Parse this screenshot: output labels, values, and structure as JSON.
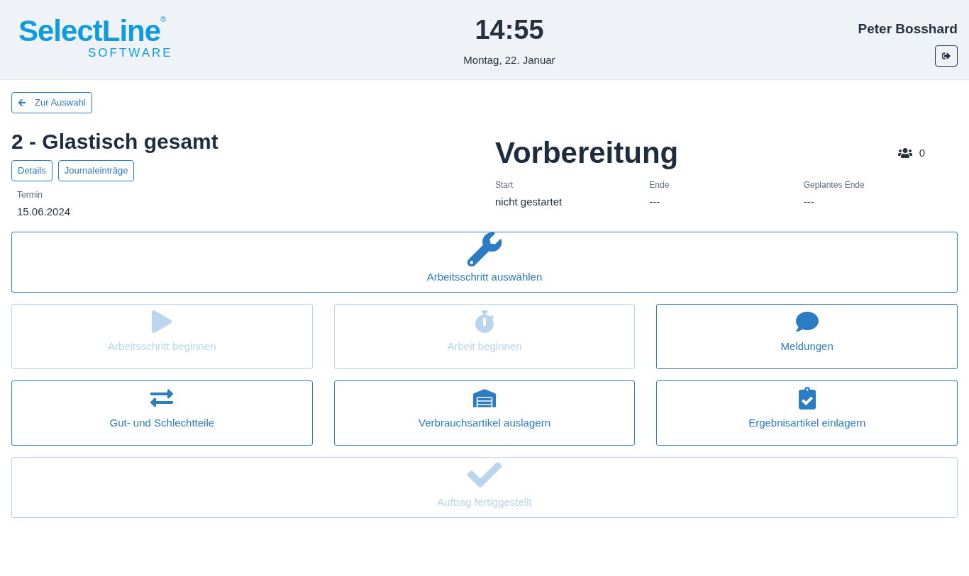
{
  "header": {
    "logo": {
      "name": "SelectLine",
      "mark": "®",
      "sub": "SOFTWARE"
    },
    "time": "14:55",
    "date": "Montag, 22. Januar",
    "user": "Peter Bosshard"
  },
  "back_button": "Zur Auswahl",
  "order": {
    "title": "2 - Glastisch gesamt",
    "buttons": [
      "Details",
      "Journaleinträge"
    ],
    "fields": [
      {
        "label": "Termin",
        "value": "15.06.2024"
      }
    ]
  },
  "status": {
    "title": "Vorbereitung",
    "workers": "0",
    "fields": [
      {
        "label": "Start",
        "value": "nicht gestartet"
      },
      {
        "label": "Ende",
        "value": "---"
      },
      {
        "label": "Geplantes Ende",
        "value": "---"
      }
    ]
  },
  "action_rows": [
    [
      {
        "label": "Arbeitsschritt auswählen",
        "kind": "select",
        "disabled": false
      }
    ],
    [
      {
        "label": "Arbeitsschritt beginnen",
        "kind": "start",
        "disabled": true
      },
      {
        "label": "Arbeit beginnen",
        "kind": "timer",
        "disabled": true
      },
      {
        "label": "Meldungen",
        "kind": "messages",
        "disabled": false
      }
    ],
    [
      {
        "label": "Gut- und Schlechtteile",
        "kind": "parts",
        "disabled": false
      },
      {
        "label": "Verbrauchsartikel auslagern",
        "kind": "outbound",
        "disabled": false
      },
      {
        "label": "Ergebnisartikel einlagern",
        "kind": "inbound",
        "disabled": false
      }
    ],
    [
      {
        "label": "Auftrag fertiggestellt",
        "kind": "finish",
        "disabled": true
      }
    ]
  ]
}
